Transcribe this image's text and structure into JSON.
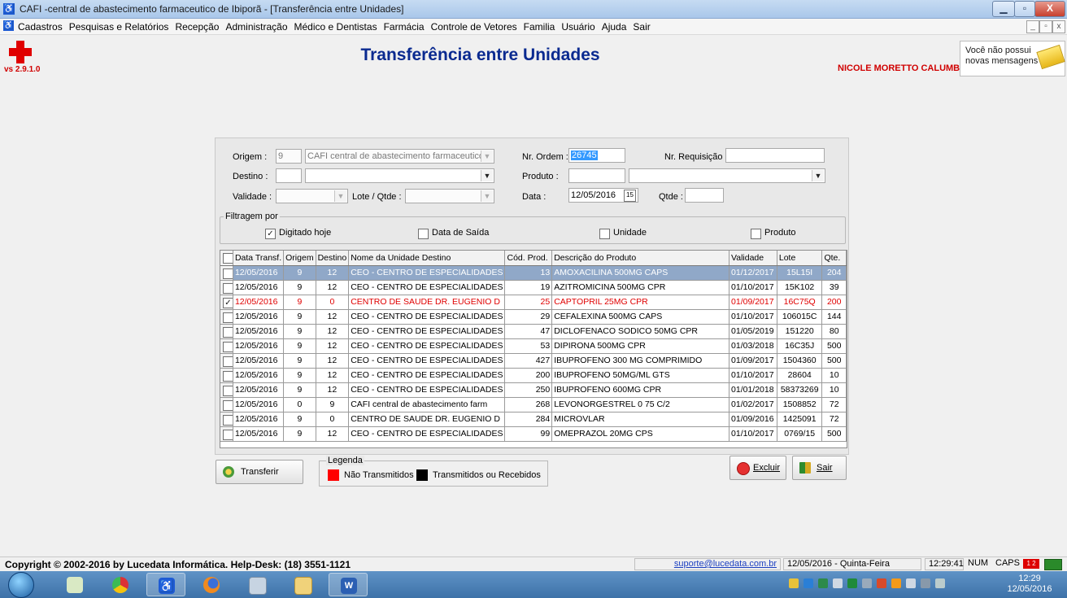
{
  "window": {
    "title": "CAFI -central de abastecimento farmaceutico de Ibiporã - [Transferência entre Unidades]",
    "controls": {
      "minimize": "▁",
      "maximize": "▫",
      "close": "X"
    }
  },
  "menu": {
    "items": [
      "Cadastros",
      "Pesquisas e Relatórios",
      "Recepção",
      "Administração",
      "Médico e Dentistas",
      "Farmácia",
      "Controle de Vetores",
      "Familia",
      "Usuário",
      "Ajuda",
      "Sair"
    ],
    "mdi": {
      "minimize": "_",
      "restore": "▫",
      "close": "x"
    }
  },
  "header": {
    "version": "vs 2.9.1.0",
    "page_title": "Transferência entre Unidades",
    "user": "NICOLE MORETTO CALUMBI",
    "messages": "Você não possui novas mensagens"
  },
  "form": {
    "origem_label": "Origem :",
    "origem_code": "9",
    "origem_name": "CAFI central de abastecimento farmaceutico c",
    "destino_label": "Destino :",
    "destino_code": "",
    "destino_name": "",
    "validade_label": "Validade :",
    "validade_value": "",
    "lote_label": "Lote / Qtde :",
    "lote_value": "",
    "nr_ordem_label": "Nr. Ordem :",
    "nr_ordem_value": "26745",
    "nr_requisicao_label": "Nr. Requisição :",
    "nr_requisicao_value": "",
    "produto_label": "Produto :",
    "produto_code": "",
    "produto_name": "",
    "data_label": "Data :",
    "data_value": "12/05/2016",
    "qtde_label": "Qtde :",
    "qtde_value": ""
  },
  "filter": {
    "legend": "Filtragem por",
    "options": [
      {
        "label": "Digitado hoje",
        "checked": true
      },
      {
        "label": "Data de Saída",
        "checked": false
      },
      {
        "label": "Unidade",
        "checked": false
      },
      {
        "label": "Produto",
        "checked": false
      }
    ]
  },
  "table": {
    "headers": [
      "Data Transf.",
      "Origem",
      "Destino",
      "Nome da Unidade Destino",
      "Cód. Prod.",
      "Descrição do Produto",
      "Validade",
      "Lote",
      "Qte."
    ],
    "rows": [
      {
        "checked": false,
        "state": "selected",
        "cells": [
          "12/05/2016",
          "9",
          "12",
          "CEO - CENTRO DE ESPECIALIDADES",
          "13",
          "AMOXACILINA 500MG CAPS",
          "01/12/2017",
          "15L15I",
          "204"
        ]
      },
      {
        "checked": false,
        "state": "",
        "cells": [
          "12/05/2016",
          "9",
          "12",
          "CEO - CENTRO DE ESPECIALIDADES",
          "19",
          "AZITROMICINA 500MG CPR",
          "01/10/2017",
          "15K102",
          "39"
        ]
      },
      {
        "checked": true,
        "state": "red",
        "cells": [
          "12/05/2016",
          "9",
          "0",
          "CENTRO DE SAUDE DR. EUGENIO D",
          "25",
          "CAPTOPRIL 25MG CPR",
          "01/09/2017",
          "16C75Q",
          "200"
        ]
      },
      {
        "checked": false,
        "state": "",
        "cells": [
          "12/05/2016",
          "9",
          "12",
          "CEO - CENTRO DE ESPECIALIDADES",
          "29",
          "CEFALEXINA 500MG CAPS",
          "01/10/2017",
          "106015C",
          "144"
        ]
      },
      {
        "checked": false,
        "state": "",
        "cells": [
          "12/05/2016",
          "9",
          "12",
          "CEO - CENTRO DE ESPECIALIDADES",
          "47",
          "DICLOFENACO SODICO 50MG CPR",
          "01/05/2019",
          "151220",
          "80"
        ]
      },
      {
        "checked": false,
        "state": "",
        "cells": [
          "12/05/2016",
          "9",
          "12",
          "CEO - CENTRO DE ESPECIALIDADES",
          "53",
          "DIPIRONA 500MG CPR",
          "01/03/2018",
          "16C35J",
          "500"
        ]
      },
      {
        "checked": false,
        "state": "",
        "cells": [
          "12/05/2016",
          "9",
          "12",
          "CEO - CENTRO DE ESPECIALIDADES",
          "427",
          "IBUPROFENO 300 MG COMPRIMIDO",
          "01/09/2017",
          "1504360",
          "500"
        ]
      },
      {
        "checked": false,
        "state": "",
        "cells": [
          "12/05/2016",
          "9",
          "12",
          "CEO - CENTRO DE ESPECIALIDADES",
          "200",
          "IBUPROFENO 50MG/ML GTS",
          "01/10/2017",
          "28604",
          "10"
        ]
      },
      {
        "checked": false,
        "state": "",
        "cells": [
          "12/05/2016",
          "9",
          "12",
          "CEO - CENTRO DE ESPECIALIDADES",
          "250",
          "IBUPROFENO 600MG CPR",
          "01/01/2018",
          "58373269",
          "10"
        ]
      },
      {
        "checked": false,
        "state": "",
        "cells": [
          "12/05/2016",
          "0",
          "9",
          "CAFI central de abastecimento farm",
          "268",
          "LEVONORGESTREL 0 75 C/2",
          "01/02/2017",
          "1508852",
          "72"
        ]
      },
      {
        "checked": false,
        "state": "",
        "cells": [
          "12/05/2016",
          "9",
          "0",
          "CENTRO DE SAUDE DR. EUGENIO D",
          "284",
          "MICROVLAR",
          "01/09/2016",
          "1425091",
          "72"
        ]
      },
      {
        "checked": false,
        "state": "",
        "cells": [
          "12/05/2016",
          "9",
          "12",
          "CEO - CENTRO DE ESPECIALIDADES",
          "99",
          "OMEPRAZOL 20MG CPS",
          "01/10/2017",
          "0769/15",
          "500"
        ]
      }
    ]
  },
  "buttons": {
    "transferir": "Transferir",
    "excluir": "Excluir",
    "sair": "Sair"
  },
  "legend": {
    "title": "Legenda",
    "items": [
      {
        "label": "Não Transmitidos",
        "color": "#ff0000"
      },
      {
        "label": "Transmitidos ou Recebidos",
        "color": "#000000"
      }
    ]
  },
  "status": {
    "copyright": "Copyright © 2002-2016 by Lucedata Informática. Help-Desk: (18) 3551-1121",
    "email": "suporte@lucedata.com.br",
    "date": "12/05/2016 - Quinta-Feira",
    "time": "12:29:41",
    "num": "NUM",
    "caps": "CAPS"
  },
  "taskbar": {
    "apps": [
      "windows-start-icon",
      "file-manager-icon",
      "chrome-icon",
      "cafi-app-icon",
      "firefox-icon",
      "calculator-icon",
      "explorer-folder-icon",
      "word-icon"
    ],
    "clock_time": "12:29",
    "clock_date": "12/05/2016"
  },
  "colors": {
    "title_blue": "#0a2a90",
    "user_red": "#d00000",
    "selected_row": "#90a8c8",
    "untransmitted_red": "#e00000"
  }
}
